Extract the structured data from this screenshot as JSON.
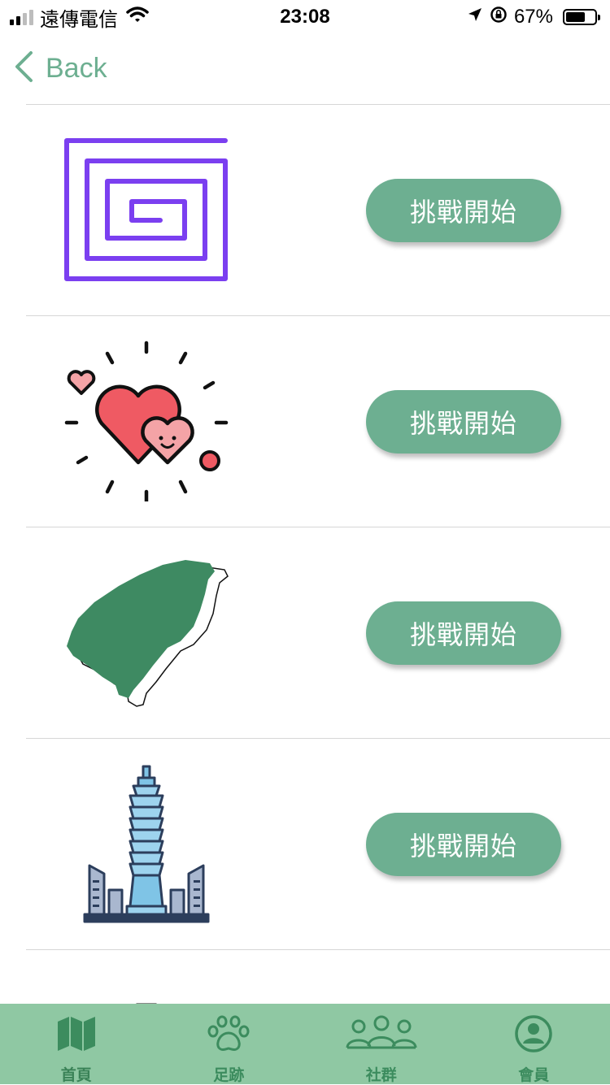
{
  "status_bar": {
    "carrier": "遠傳電信",
    "time": "23:08",
    "battery": "67%",
    "battery_level": 0.67
  },
  "nav": {
    "back_label": "Back"
  },
  "challenges": [
    {
      "icon": "maze-spiral-icon",
      "button_label": "挑戰開始"
    },
    {
      "icon": "hearts-icon",
      "button_label": "挑戰開始"
    },
    {
      "icon": "taiwan-map-icon",
      "button_label": "挑戰開始"
    },
    {
      "icon": "taipei-101-icon",
      "button_label": "挑戰開始"
    }
  ],
  "tab_bar": {
    "tabs": [
      {
        "label": "首頁",
        "icon": "map-icon"
      },
      {
        "label": "足跡",
        "icon": "paw-icon"
      },
      {
        "label": "社群",
        "icon": "community-icon"
      },
      {
        "label": "會員",
        "icon": "user-icon"
      }
    ]
  },
  "colors": {
    "accent": "#6daf91",
    "tab_bar": "#8fc8a3",
    "tab_icon": "#3c8c5e"
  }
}
